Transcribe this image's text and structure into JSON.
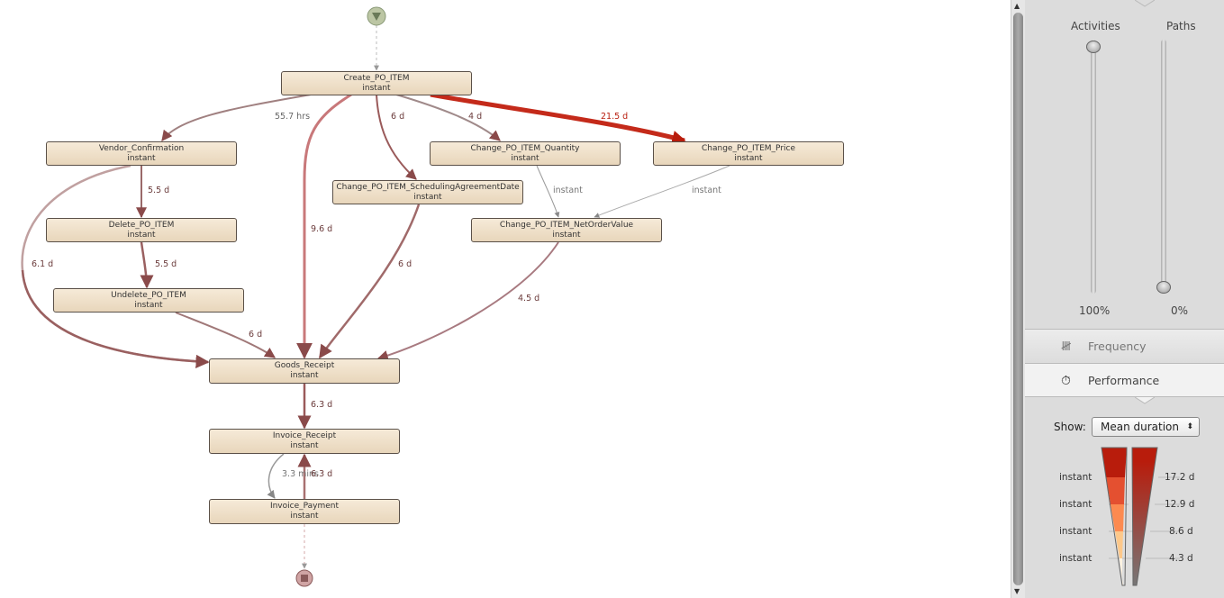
{
  "nodes": [
    {
      "id": "create",
      "label": "Create_PO_ITEM",
      "sub": "instant"
    },
    {
      "id": "vendor",
      "label": "Vendor_Confirmation",
      "sub": "instant"
    },
    {
      "id": "qty",
      "label": "Change_PO_ITEM_Quantity",
      "sub": "instant"
    },
    {
      "id": "price",
      "label": "Change_PO_ITEM_Price",
      "sub": "instant"
    },
    {
      "id": "sched",
      "label": "Change_PO_ITEM_SchedulingAgreementDate",
      "sub": "instant"
    },
    {
      "id": "delete",
      "label": "Delete_PO_ITEM",
      "sub": "instant"
    },
    {
      "id": "netval",
      "label": "Change_PO_ITEM_NetOrderValue",
      "sub": "instant"
    },
    {
      "id": "undelete",
      "label": "Undelete_PO_ITEM",
      "sub": "instant"
    },
    {
      "id": "goods",
      "label": "Goods_Receipt",
      "sub": "instant"
    },
    {
      "id": "invrec",
      "label": "Invoice_Receipt",
      "sub": "instant"
    },
    {
      "id": "invpay",
      "label": "Invoice_Payment",
      "sub": "instant"
    }
  ],
  "edges": [
    {
      "from": "create",
      "to": "vendor",
      "label": "55.7 hrs"
    },
    {
      "from": "create",
      "to": "goods",
      "label": "9.6 d"
    },
    {
      "from": "create",
      "to": "sched",
      "label": "6 d"
    },
    {
      "from": "create",
      "to": "qty",
      "label": "4 d"
    },
    {
      "from": "create",
      "to": "price",
      "label": "21.5 d"
    },
    {
      "from": "vendor",
      "to": "delete",
      "label": "5.5 d"
    },
    {
      "from": "vendor",
      "to": "goods",
      "label": "6.1 d"
    },
    {
      "from": "delete",
      "to": "undelete",
      "label": "5.5 d"
    },
    {
      "from": "undelete",
      "to": "goods",
      "label": "6 d"
    },
    {
      "from": "sched",
      "to": "goods",
      "label": "6 d"
    },
    {
      "from": "qty",
      "to": "netval",
      "label": "instant"
    },
    {
      "from": "price",
      "to": "netval",
      "label": "instant"
    },
    {
      "from": "netval",
      "to": "goods",
      "label": "4.5 d"
    },
    {
      "from": "goods",
      "to": "invrec",
      "label": "6.3 d"
    },
    {
      "from": "invrec",
      "to": "invpay",
      "label": "3.3 mins"
    },
    {
      "from": "invpay",
      "to": "invrec",
      "label": "6.3 d"
    }
  ],
  "panel": {
    "activities_label": "Activities",
    "paths_label": "Paths",
    "activities_value": "100%",
    "paths_value": "0%",
    "activities_level": 1.0,
    "paths_level": 0.0,
    "tab_frequency": "Frequency",
    "tab_performance": "Performance",
    "active_tab": "Performance",
    "show_label": "Show:",
    "show_value": "Mean duration",
    "legend_left": [
      "instant",
      "instant",
      "instant",
      "instant"
    ],
    "legend_right": [
      "17.2 d",
      "12.9 d",
      "8.6 d",
      "4.3 d"
    ]
  },
  "colors": {
    "accent": "#b81c0c",
    "node_fill": "#f2e4cc",
    "edge": "#8a4a4a"
  },
  "icons": {
    "start": "play-down-icon",
    "end": "stop-icon",
    "frequency": "tally-icon",
    "performance": "stopwatch-icon"
  }
}
